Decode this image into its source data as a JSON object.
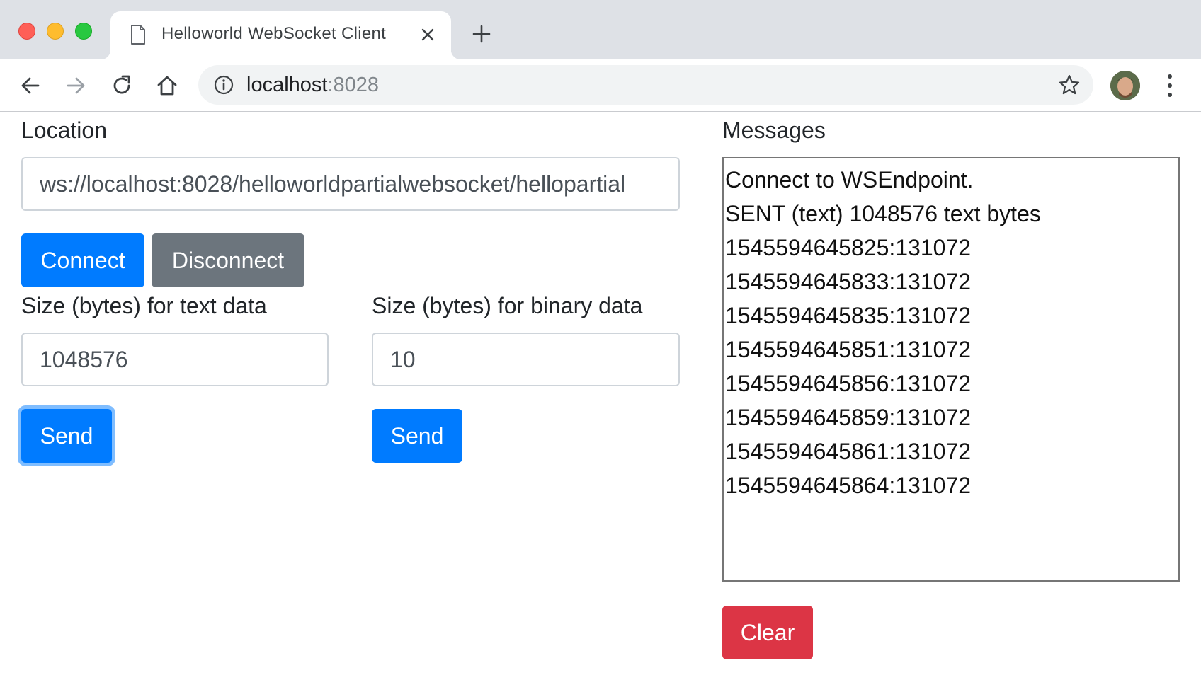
{
  "browser": {
    "tab_title": "Helloworld WebSocket Client",
    "url_host": "localhost",
    "url_port": ":8028"
  },
  "page": {
    "location_label": "Location",
    "location_value": "ws://localhost:8028/helloworldpartialwebsocket/hellopartial",
    "connect_label": "Connect",
    "disconnect_label": "Disconnect",
    "text_size_label": "Size (bytes) for text data",
    "text_size_value": "1048576",
    "binary_size_label": "Size (bytes) for binary data",
    "binary_size_value": "10",
    "send_text_label": "Send",
    "send_binary_label": "Send",
    "messages_label": "Messages",
    "messages": [
      "Connect to WSEndpoint.",
      "SENT (text) 1048576 text bytes",
      "1545594645825:131072",
      "1545594645833:131072",
      "1545594645835:131072",
      "1545594645851:131072",
      "1545594645856:131072",
      "1545594645859:131072",
      "1545594645861:131072",
      "1545594645864:131072"
    ],
    "clear_label": "Clear"
  },
  "colors": {
    "primary": "#007bff",
    "secondary": "#6c757d",
    "danger": "#dc3545"
  }
}
